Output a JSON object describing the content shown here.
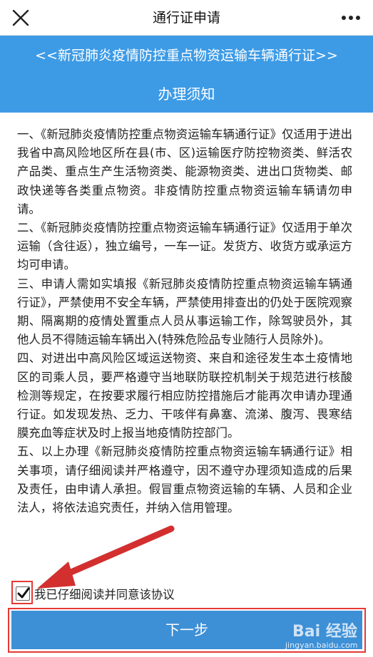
{
  "topbar": {
    "title": "通行证申请",
    "close_icon": "close-icon",
    "more_icon": "more-icon"
  },
  "banner": {
    "heading": "<<新冠肺炎疫情防控重点物资运输车辆通行证>>",
    "subheading": "办理须知"
  },
  "notice": {
    "paragraphs": [
      "一、《新冠肺炎疫情防控重点物资运输车辆通行证》仅适用于进出我省中高风险地区所在县(市、区)运输医疗防控物资类、鲜活农产品类、重点生产生活物资类、能源物资类、进出口货物类、邮政快递等各类重点物资。非疫情防控重点物资运输车辆请勿申请。",
      "二、《新冠肺炎疫情防控重点物资运输车辆通行证》仅适用于单次运输（含往返），独立编号，一车一证。发货方、收货方或承运方均可申请。",
      "三、申请人需如实填报《新冠肺炎疫情防控重点物资运输车辆通行证》，严禁使用不安全车辆，严禁使用排查出的仍处于医院观察期、隔离期的疫情处置重点人员从事运输工作，除驾驶员外，其他人员不得随运输车辆出入(特殊危险品专业随行人员除外)。",
      "四、对进出中高风险区域运送物资、来自和途径发生本土疫情地区的司乘人员，要严格遵守当地联防联控机制关于规范进行核酸检测等规定，在按要求履行相应防控措施后才能再次申请办理通行证。如发现发热、乏力、干咳伴有鼻塞、流涕、腹泻、畏寒结膜充血等症状及时上报当地疫情防控部门。",
      "五、以上办理《新冠肺炎疫情防控重点物资运输车辆通行证》相关事项，请仔细阅读并严格遵守，因不遵守办理须知造成的后果及责任，由申请人承担。假冒重点物资运输的车辆、人员和企业法人，将依法追究责任，并纳入信用管理。"
    ]
  },
  "agreement": {
    "checked": true,
    "label": "我已仔细阅读并同意该协议"
  },
  "next_button": {
    "label": "下一步"
  },
  "watermark": {
    "main": "Bai 经验",
    "sub": "jingyan.baidu.com"
  },
  "colors": {
    "banner": "#3d9be6",
    "button": "#3d8fd6",
    "highlight": "#e53935"
  }
}
